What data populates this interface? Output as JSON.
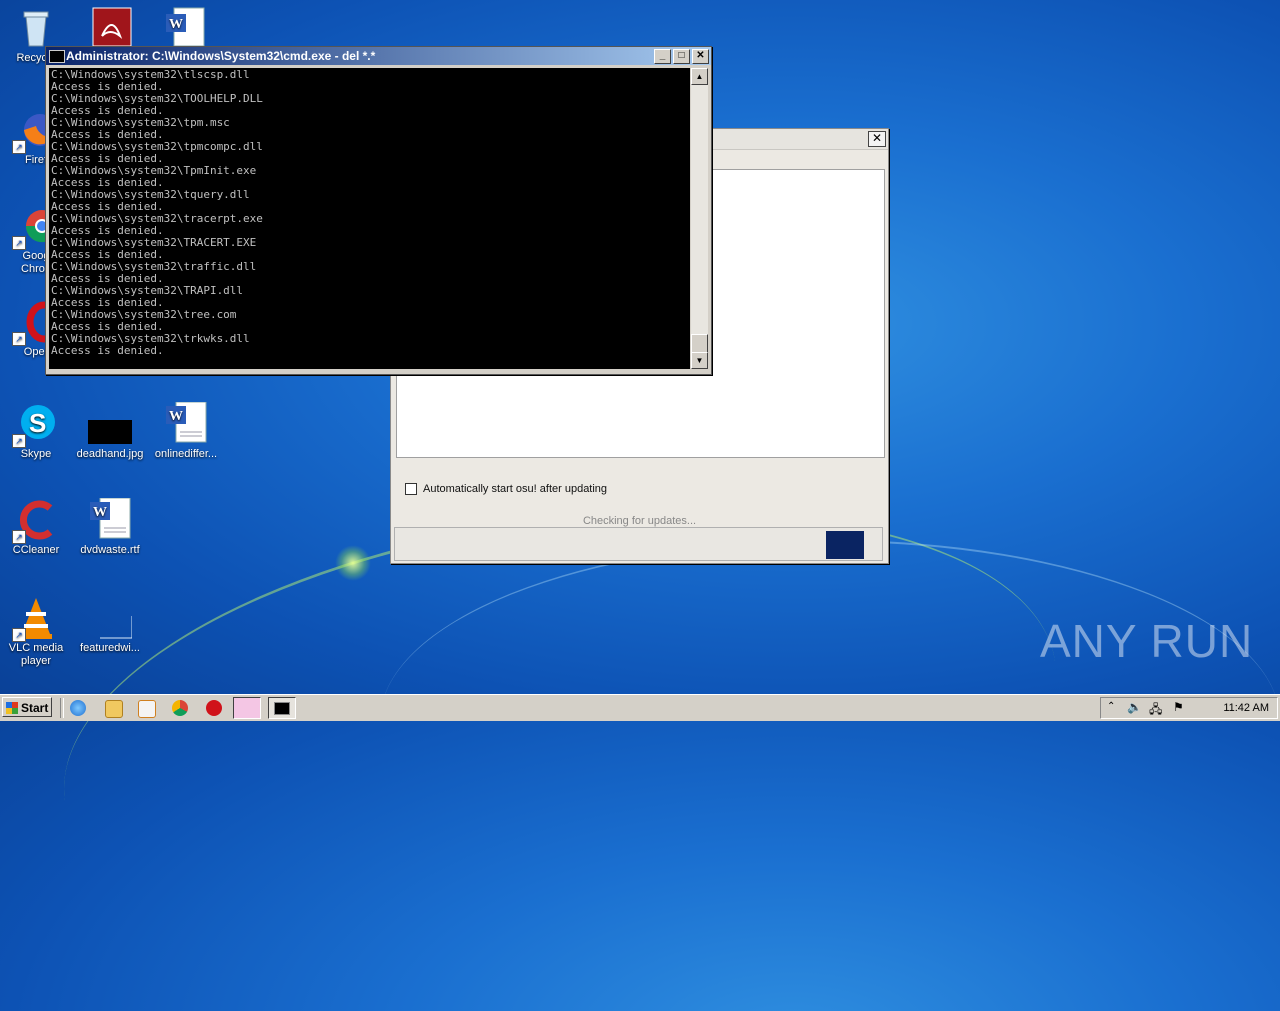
{
  "desktop": {
    "icons": [
      {
        "name": "recycle-bin",
        "label": "Recycle"
      },
      {
        "name": "firefox",
        "label": "Firef"
      },
      {
        "name": "google-chrome",
        "label": "Goog\nChron"
      },
      {
        "name": "opera",
        "label": "Oper"
      },
      {
        "name": "skype",
        "label": "Skype"
      },
      {
        "name": "deadhand",
        "label": "deadhand.jpg"
      },
      {
        "name": "onlinediffer",
        "label": "onlinediffer..."
      },
      {
        "name": "ccleaner",
        "label": "CCleaner"
      },
      {
        "name": "dvdwaste",
        "label": "dvdwaste.rtf"
      },
      {
        "name": "vlc",
        "label": "VLC media\nplayer"
      },
      {
        "name": "featuredw",
        "label": "featuredwi..."
      }
    ]
  },
  "cmd_window": {
    "title": "Administrator: C:\\Windows\\System32\\cmd.exe - del  *.*",
    "lines": [
      "C:\\Windows\\system32\\tlscsp.dll",
      "Access is denied.",
      "C:\\Windows\\system32\\TOOLHELP.DLL",
      "Access is denied.",
      "C:\\Windows\\system32\\tpm.msc",
      "Access is denied.",
      "C:\\Windows\\system32\\tpmcompc.dll",
      "Access is denied.",
      "C:\\Windows\\system32\\TpmInit.exe",
      "Access is denied.",
      "C:\\Windows\\system32\\tquery.dll",
      "Access is denied.",
      "C:\\Windows\\system32\\tracerpt.exe",
      "Access is denied.",
      "C:\\Windows\\system32\\TRACERT.EXE",
      "Access is denied.",
      "C:\\Windows\\system32\\traffic.dll",
      "Access is denied.",
      "C:\\Windows\\system32\\TRAPI.dll",
      "Access is denied.",
      "C:\\Windows\\system32\\tree.com",
      "Access is denied.",
      "C:\\Windows\\system32\\trkwks.dll",
      "Access is denied."
    ]
  },
  "osu_updater": {
    "auto_start_label": "Automatically start osu! after updating",
    "auto_start_checked": false,
    "status": "Checking for updates..."
  },
  "taskbar": {
    "start_label": "Start",
    "clock": "11:42 AM"
  },
  "watermark": "ANY RUN",
  "colors": {
    "desktop": "#1a6fd0",
    "title_active": "#0a246a",
    "osu_button": "#0a2462"
  }
}
